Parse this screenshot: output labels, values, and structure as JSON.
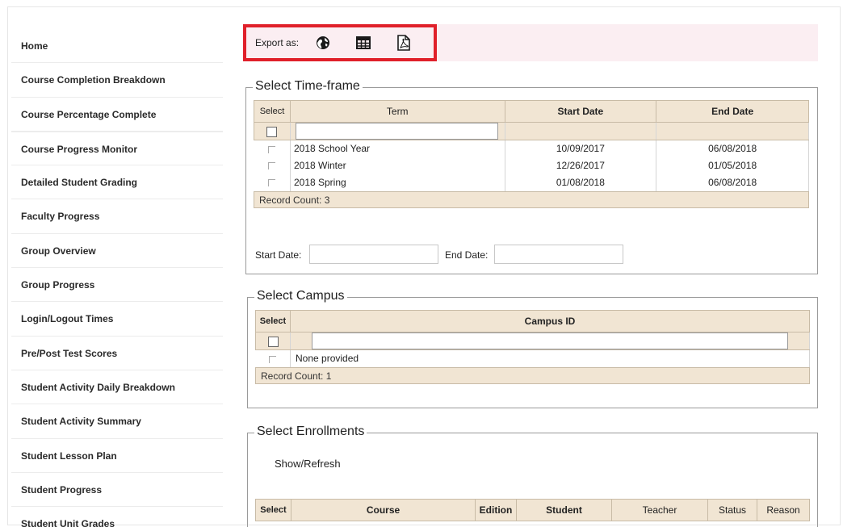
{
  "sidebar": {
    "items": [
      {
        "label": "Home"
      },
      {
        "label": "Course Completion Breakdown"
      },
      {
        "label": "Course Percentage Complete"
      },
      {
        "label": "Course Progress Monitor"
      },
      {
        "label": "Detailed Student Grading"
      },
      {
        "label": "Faculty Progress"
      },
      {
        "label": "Group Overview"
      },
      {
        "label": "Group Progress"
      },
      {
        "label": "Login/Logout Times"
      },
      {
        "label": "Pre/Post Test Scores"
      },
      {
        "label": "Student Activity Daily Breakdown"
      },
      {
        "label": "Student Activity Summary"
      },
      {
        "label": "Student Lesson Plan"
      },
      {
        "label": "Student Progress"
      },
      {
        "label": "Student Unit Grades"
      }
    ]
  },
  "export": {
    "label": "Export as:",
    "icons": [
      "globe-icon",
      "table-grid-icon",
      "pdf-icon"
    ],
    "highlight_color": "#e0202a",
    "bar_color": "#fbeef2"
  },
  "timeframe": {
    "legend": "Select Time-frame",
    "columns": {
      "select": "Select",
      "term": "Term",
      "start": "Start Date",
      "end": "End Date"
    },
    "rows": [
      {
        "term": "2018 School Year",
        "start": "10/09/2017",
        "end": "06/08/2018"
      },
      {
        "term": "2018 Winter",
        "start": "12/26/2017",
        "end": "01/05/2018"
      },
      {
        "term": "2018 Spring",
        "start": "01/08/2018",
        "end": "06/08/2018"
      }
    ],
    "record_count": "Record Count: 3",
    "start_date_label": "Start Date:",
    "end_date_label": "End Date:"
  },
  "campus": {
    "legend": "Select Campus",
    "columns": {
      "select": "Select",
      "campus_id": "Campus ID"
    },
    "rows": [
      {
        "campus_id": "None provided"
      }
    ],
    "record_count": "Record Count: 1"
  },
  "enrollments": {
    "legend": "Select Enrollments",
    "show_refresh": "Show/Refresh",
    "columns": {
      "select": "Select",
      "course": "Course",
      "edition": "Edition",
      "student": "Student",
      "teacher": "Teacher",
      "status": "Status",
      "reason": "Reason"
    }
  },
  "theme": {
    "table_header_bg": "#f1e5d3"
  }
}
